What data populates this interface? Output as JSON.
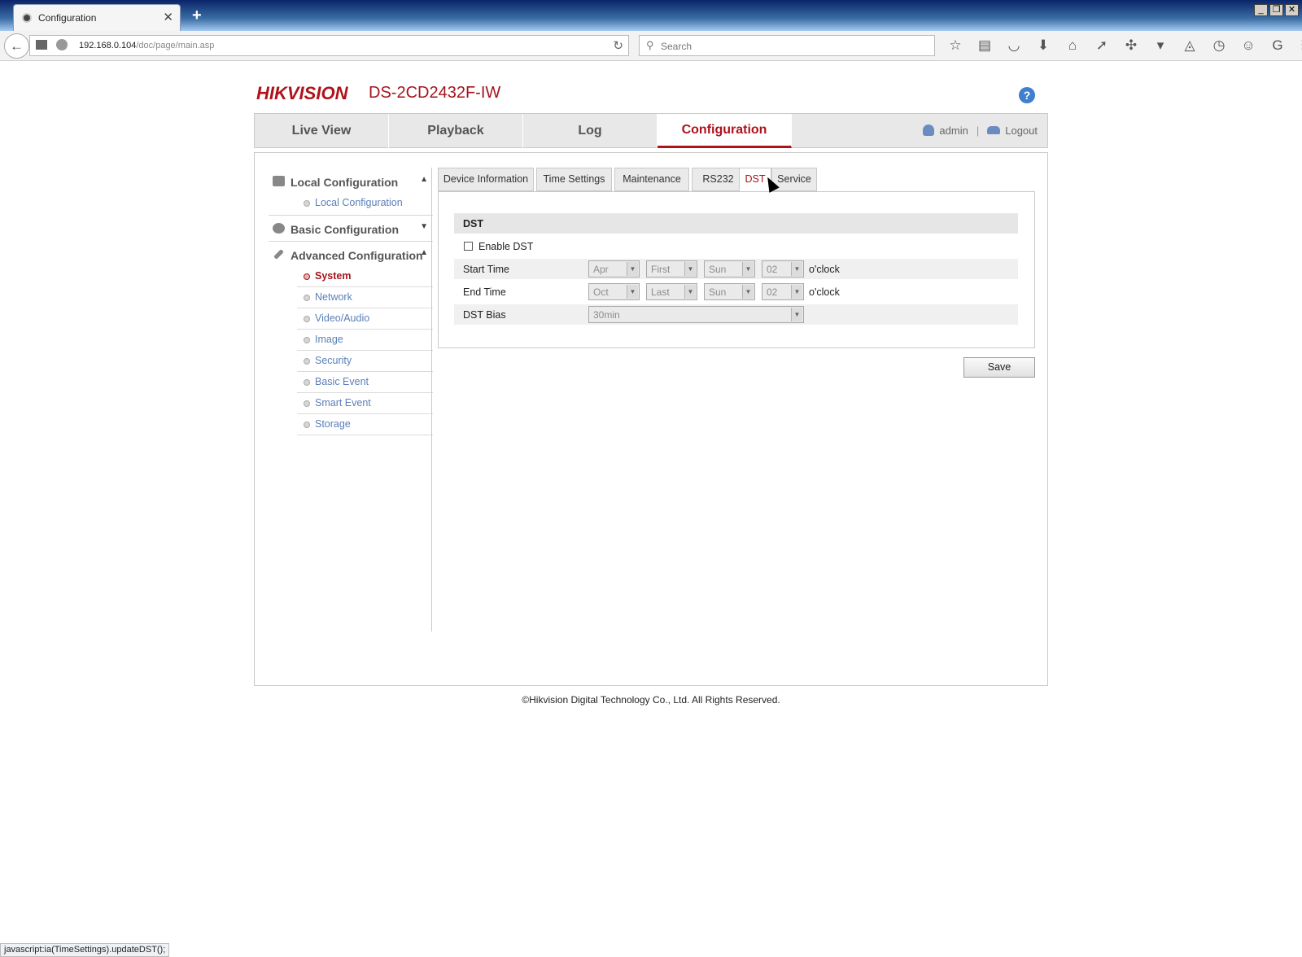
{
  "browser": {
    "tab_title": "Configuration",
    "url_host": "192.168.0.104",
    "url_path": "/doc/page/main.asp",
    "search_placeholder": "Search",
    "status_text": "javascript:ia(TimeSettings).updateDST();"
  },
  "header": {
    "logo": "HIKVISION",
    "model": "DS-2CD2432F-IW",
    "help": "?"
  },
  "topnav": {
    "items": [
      {
        "label": "Live View"
      },
      {
        "label": "Playback"
      },
      {
        "label": "Log"
      },
      {
        "label": "Configuration",
        "active": true
      }
    ],
    "user": "admin",
    "separator": "|",
    "logout": "Logout"
  },
  "sidebar": {
    "sections": [
      {
        "label": "Local Configuration",
        "expanded": true,
        "items": [
          "Local Configuration"
        ]
      },
      {
        "label": "Basic Configuration",
        "expanded": false,
        "items": []
      },
      {
        "label": "Advanced Configuration",
        "expanded": true,
        "items": [
          "System",
          "Network",
          "Video/Audio",
          "Image",
          "Security",
          "Basic Event",
          "Smart Event",
          "Storage"
        ],
        "active_item": "System"
      }
    ]
  },
  "tabs": {
    "items": [
      "Device Information",
      "Time Settings",
      "Maintenance",
      "RS232",
      "DST",
      "Service"
    ],
    "active": "DST"
  },
  "dst": {
    "section_title": "DST",
    "enable_label": "Enable DST",
    "enabled": false,
    "start_label": "Start Time",
    "start": {
      "month": "Apr",
      "week": "First",
      "day": "Sun",
      "hour": "02"
    },
    "end_label": "End Time",
    "end": {
      "month": "Oct",
      "week": "Last",
      "day": "Sun",
      "hour": "02"
    },
    "oclock": "o'clock",
    "bias_label": "DST Bias",
    "bias": "30min"
  },
  "save_label": "Save",
  "footer": "©Hikvision Digital Technology Co., Ltd. All Rights Reserved.",
  "colors": {
    "accent": "#b0121c",
    "link": "#5b7fb8"
  }
}
